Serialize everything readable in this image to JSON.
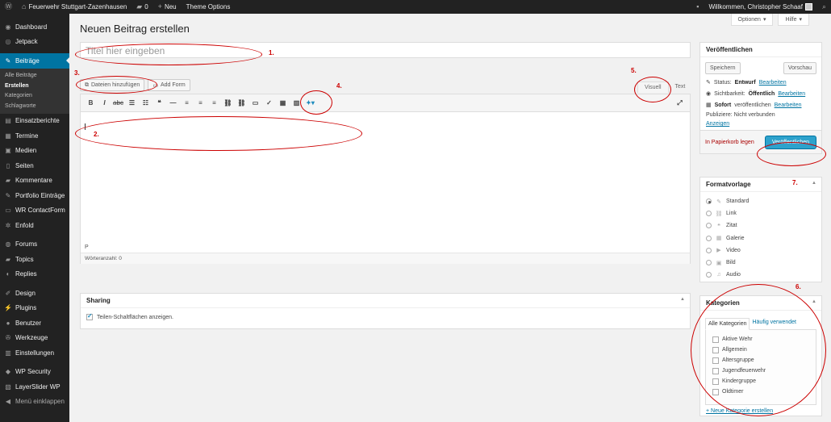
{
  "adminbar": {
    "site_name": "Feuerwehr Stuttgart-Zazenhausen",
    "comments_count": "0",
    "new_label": "Neu",
    "theme_options": "Theme Options",
    "greeting": "Willkommen, Christopher Schaaf"
  },
  "screen_tabs": {
    "options": "Optionen",
    "help": "Hilfe"
  },
  "sidebar": {
    "items": [
      {
        "label": "Dashboard",
        "icon": "dashboard-icon"
      },
      {
        "label": "Jetpack",
        "icon": "jetpack-icon"
      },
      {
        "label": "Beiträge",
        "icon": "pin-icon",
        "active": true
      },
      {
        "label": "Einsatzberichte",
        "icon": "post-icon"
      },
      {
        "label": "Termine",
        "icon": "calendar-icon"
      },
      {
        "label": "Medien",
        "icon": "media-icon"
      },
      {
        "label": "Seiten",
        "icon": "page-icon"
      },
      {
        "label": "Kommentare",
        "icon": "comment-icon"
      },
      {
        "label": "Portfolio Einträge",
        "icon": "pin-icon"
      },
      {
        "label": "WR ContactForm",
        "icon": "form-icon"
      },
      {
        "label": "Enfold",
        "icon": "gear-icon"
      },
      {
        "label": "Forums",
        "icon": "forum-icon"
      },
      {
        "label": "Topics",
        "icon": "topic-icon"
      },
      {
        "label": "Replies",
        "icon": "reply-icon"
      },
      {
        "label": "Design",
        "icon": "brush-icon"
      },
      {
        "label": "Plugins",
        "icon": "plugin-icon"
      },
      {
        "label": "Benutzer",
        "icon": "user-icon"
      },
      {
        "label": "Werkzeuge",
        "icon": "wrench-icon"
      },
      {
        "label": "Einstellungen",
        "icon": "settings-icon"
      },
      {
        "label": "WP Security",
        "icon": "shield-icon"
      },
      {
        "label": "LayerSlider WP",
        "icon": "layers-icon"
      },
      {
        "label": "Menü einklappen",
        "icon": "collapse-icon"
      }
    ],
    "submenu": [
      "Alle Beiträge",
      "Erstellen",
      "Kategorien",
      "Schlagworte"
    ]
  },
  "main": {
    "page_title": "Neuen Beitrag erstellen",
    "title_placeholder": "Titel hier eingeben",
    "add_media": "Dateien hinzufügen",
    "add_form": "Add Form",
    "tab_visual": "Visuell",
    "tab_text": "Text",
    "path": "P",
    "word_count": "Wörteranzahl: 0"
  },
  "sharing": {
    "title": "Sharing",
    "checkbox_label": "Teilen-Schaltflächen anzeigen."
  },
  "publish": {
    "title": "Veröffentlichen",
    "save_draft": "Speichern",
    "preview": "Vorschau",
    "status_label": "Status:",
    "status_value": "Entwurf",
    "visibility_label": "Sichtbarkeit:",
    "visibility_value": "Öffentlich",
    "schedule_value": "Sofort",
    "schedule_label": "veröffentlichen",
    "edit": "Bearbeiten",
    "publicize": "Publiziere: Nicht verbunden",
    "show": "Anzeigen",
    "trash": "In Papierkorb legen",
    "publish_button": "Veröffentlichen"
  },
  "formats": {
    "title": "Formatvorlage",
    "items": [
      "Standard",
      "Link",
      "Zitat",
      "Galerie",
      "Video",
      "Bild",
      "Audio"
    ]
  },
  "categories": {
    "title": "Kategorien",
    "tab_all": "Alle Kategorien",
    "tab_popular": "Häufig verwendet",
    "items": [
      "Aktive Wehr",
      "Allgemein",
      "Altersgruppe",
      "Jugendfeuerwehr",
      "Kindergruppe",
      "Oldtimer"
    ],
    "add_new": "+ Neue Kategorie erstellen"
  },
  "annotations": [
    "1.",
    "2.",
    "3.",
    "4.",
    "5.",
    "6.",
    "7."
  ],
  "colors": {
    "accent": "#0074a2",
    "publish": "#2ea2cc",
    "annotation": "#cc0000",
    "sidebar": "#222222"
  }
}
